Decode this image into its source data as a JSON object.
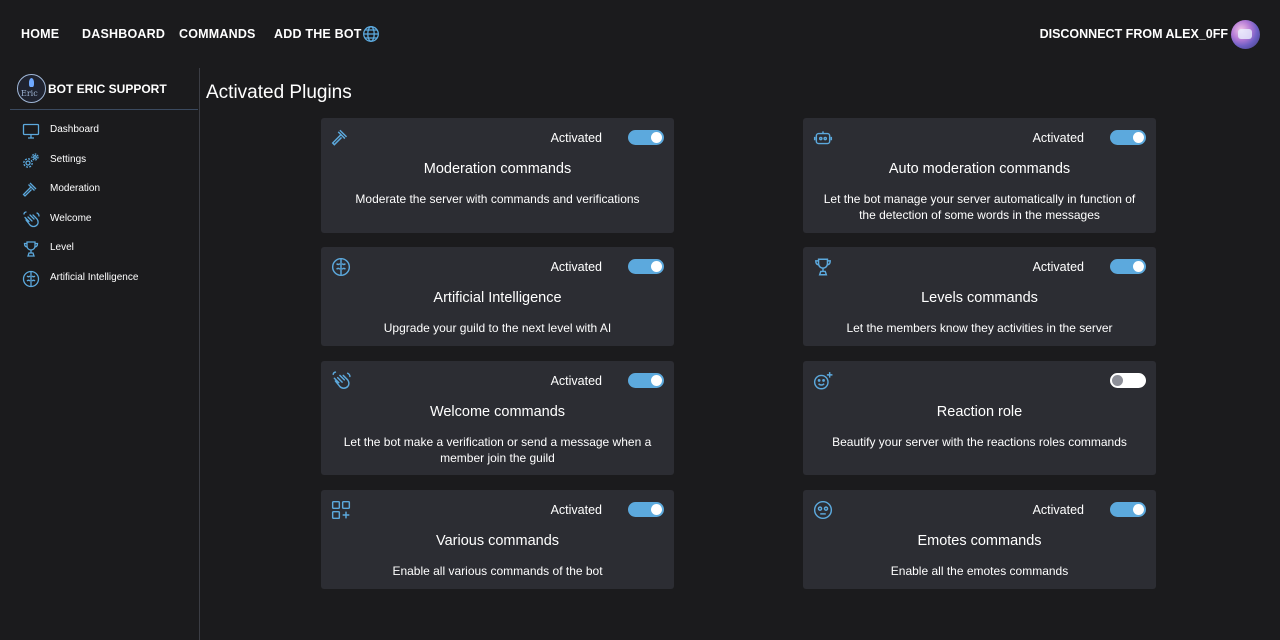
{
  "nav": {
    "home": "HOME",
    "dashboard": "DASHBOARD",
    "commands": "COMMANDS",
    "add_bot": "ADD THE BOT",
    "language_icon": "globe-icon",
    "disconnect": "DISCONNECT FROM ALEX_0FF"
  },
  "sidebar": {
    "brand": {
      "logo_text": "Eric",
      "name": "BOT ERIC SUPPORT"
    },
    "items": [
      {
        "label": "Dashboard",
        "icon": "monitor-icon"
      },
      {
        "label": "Settings",
        "icon": "gears-icon"
      },
      {
        "label": "Moderation",
        "icon": "gavel-icon"
      },
      {
        "label": "Welcome",
        "icon": "waving-hand-icon"
      },
      {
        "label": "Level",
        "icon": "trophy-icon"
      },
      {
        "label": "Artificial Intelligence",
        "icon": "brain-icon"
      }
    ]
  },
  "main": {
    "title": "Activated Plugins",
    "plugins": [
      {
        "icon": "gavel-icon",
        "status": "Activated",
        "enabled": true,
        "title": "Moderation commands",
        "description": "Moderate the server with commands and verifications"
      },
      {
        "icon": "robot-icon",
        "status": "Activated",
        "enabled": true,
        "title": "Auto moderation commands",
        "description": "Let the bot manage your server automatically in function of the detection of some words in the messages"
      },
      {
        "icon": "brain-icon",
        "status": "Activated",
        "enabled": true,
        "title": "Artificial Intelligence",
        "description": "Upgrade your guild to the next level with AI"
      },
      {
        "icon": "trophy-icon",
        "status": "Activated",
        "enabled": true,
        "title": "Levels commands",
        "description": "Let the members know they activities in the server"
      },
      {
        "icon": "waving-hand-icon",
        "status": "Activated",
        "enabled": true,
        "title": "Welcome commands",
        "description": "Let the bot make a verification or send a message when a member join the guild"
      },
      {
        "icon": "add-reaction-icon",
        "status": "",
        "enabled": false,
        "title": "Reaction role",
        "description": "Beautify your server with the reactions roles commands"
      },
      {
        "icon": "apps-add-icon",
        "status": "Activated",
        "enabled": true,
        "title": "Various commands",
        "description": "Enable all various commands of the bot"
      },
      {
        "icon": "emote-icon",
        "status": "Activated",
        "enabled": true,
        "title": "Emotes commands",
        "description": "Enable all the emotes commands"
      }
    ]
  },
  "colors": {
    "accent": "#5ca9dd",
    "card_bg": "#2c2d33",
    "page_bg": "#1b1b1d"
  }
}
